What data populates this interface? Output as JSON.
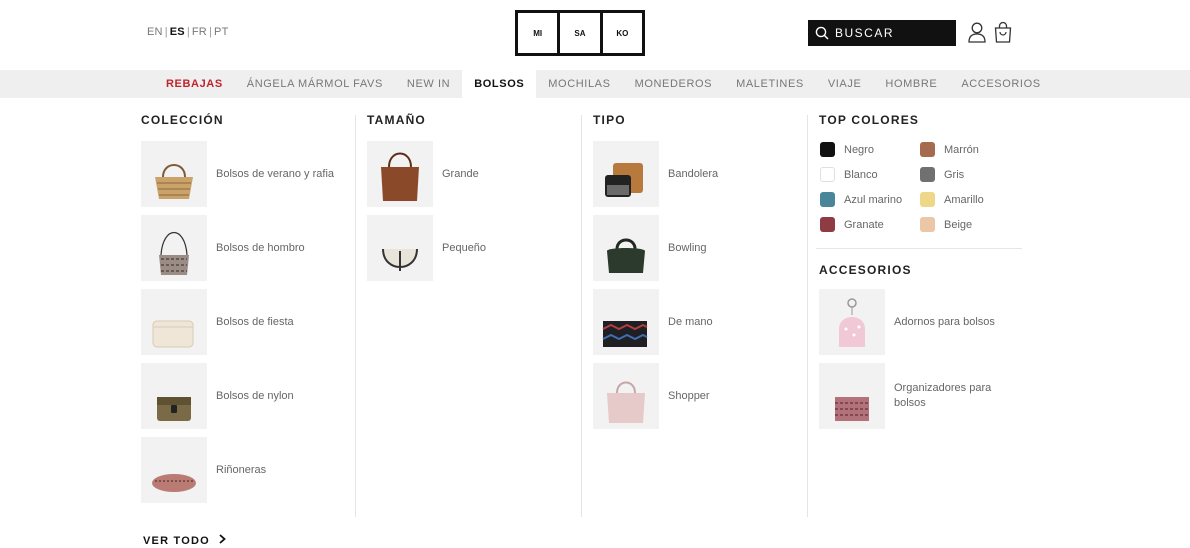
{
  "languages": [
    {
      "code": "EN",
      "active": false
    },
    {
      "code": "ES",
      "active": true
    },
    {
      "code": "FR",
      "active": false
    },
    {
      "code": "PT",
      "active": false
    }
  ],
  "logo": [
    "MI",
    "SA",
    "KO"
  ],
  "search": {
    "placeholder": "BUSCAR",
    "icon": "search-icon"
  },
  "icons": {
    "account": "user-icon",
    "cart": "shopping-bag-icon"
  },
  "colors": {
    "sale": "#c0242c",
    "nav_bg": "#efefef",
    "search_bg": "#111111"
  },
  "nav": {
    "items": [
      {
        "label": "REBAJAS",
        "state": "sale"
      },
      {
        "label": "ÁNGELA MÁRMOL FAVS",
        "state": ""
      },
      {
        "label": "NEW IN",
        "state": ""
      },
      {
        "label": "BOLSOS",
        "state": "active"
      },
      {
        "label": "MOCHILAS",
        "state": ""
      },
      {
        "label": "MONEDEROS",
        "state": ""
      },
      {
        "label": "MALETINES",
        "state": ""
      },
      {
        "label": "VIAJE",
        "state": ""
      },
      {
        "label": "HOMBRE",
        "state": ""
      },
      {
        "label": "ACCESORIOS",
        "state": ""
      }
    ]
  },
  "menu": {
    "coleccion": {
      "title": "COLECCIÓN",
      "items": [
        {
          "label": "Bolsos de verano y rafia",
          "thumb": "straw-bag"
        },
        {
          "label": "Bolsos de hombro",
          "thumb": "shoulder-bag"
        },
        {
          "label": "Bolsos de fiesta",
          "thumb": "clutch"
        },
        {
          "label": "Bolsos de nylon",
          "thumb": "nylon-bag"
        },
        {
          "label": "Riñoneras",
          "thumb": "belt-bag"
        }
      ]
    },
    "tamano": {
      "title": "TAMAÑO",
      "items": [
        {
          "label": "Grande",
          "thumb": "large-bag"
        },
        {
          "label": "Pequeño",
          "thumb": "small-bag"
        }
      ]
    },
    "tipo": {
      "title": "TIPO",
      "items": [
        {
          "label": "Bandolera",
          "thumb": "crossbody"
        },
        {
          "label": "Bowling",
          "thumb": "bowling"
        },
        {
          "label": "De mano",
          "thumb": "handbag-clutch"
        },
        {
          "label": "Shopper",
          "thumb": "shopper"
        }
      ]
    },
    "top_colores": {
      "title": "TOP COLORES",
      "items": [
        {
          "label": "Negro",
          "color": "#111111"
        },
        {
          "label": "Marrón",
          "color": "#a66a4e"
        },
        {
          "label": "Blanco",
          "color": "#ffffff"
        },
        {
          "label": "Gris",
          "color": "#707070"
        },
        {
          "label": "Azul marino",
          "color": "#4a8699"
        },
        {
          "label": "Amarillo",
          "color": "#efd789"
        },
        {
          "label": "Granate",
          "color": "#8f3b44"
        },
        {
          "label": "Beige",
          "color": "#ebc7a7"
        }
      ]
    },
    "accesorios": {
      "title": "ACCESORIOS",
      "items": [
        {
          "label": "Adornos para bolsos",
          "thumb": "bag-charm"
        },
        {
          "label": "Organizadores para bolsos",
          "thumb": "organizer"
        }
      ]
    }
  },
  "see_all": {
    "label": "VER TODO",
    "icon": "chevron-right-icon"
  }
}
